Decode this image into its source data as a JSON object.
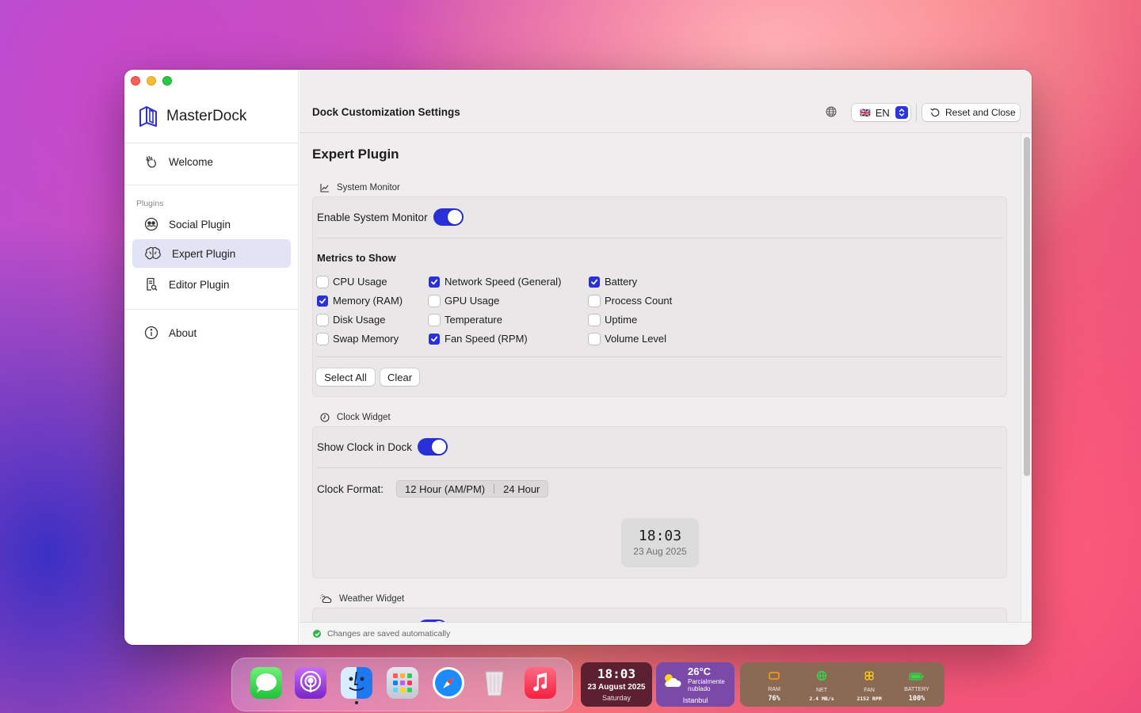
{
  "app": {
    "name": "MasterDock"
  },
  "sidebar": {
    "welcome": "Welcome",
    "plugins_section": "Plugins",
    "items": [
      {
        "label": "Social Plugin"
      },
      {
        "label": "Expert Plugin",
        "active": true
      },
      {
        "label": "Editor Plugin"
      }
    ],
    "about": "About"
  },
  "toolbar": {
    "title": "Dock Customization Settings",
    "language": {
      "flag": "🇬🇧",
      "value": "EN"
    },
    "reset_label": "Reset and Close"
  },
  "page": {
    "title": "Expert Plugin"
  },
  "system_monitor": {
    "section_label": "System Monitor",
    "enable_label": "Enable System Monitor",
    "enabled": true,
    "metrics_title": "Metrics to Show",
    "metrics": [
      {
        "label": "CPU Usage",
        "checked": false
      },
      {
        "label": "Memory (RAM)",
        "checked": true
      },
      {
        "label": "Disk Usage",
        "checked": false
      },
      {
        "label": "Swap Memory",
        "checked": false
      },
      {
        "label": "Network Speed (General)",
        "checked": true
      },
      {
        "label": "GPU Usage",
        "checked": false
      },
      {
        "label": "Temperature",
        "checked": false
      },
      {
        "label": "Fan Speed (RPM)",
        "checked": true
      },
      {
        "label": "Battery",
        "checked": true
      },
      {
        "label": "Process Count",
        "checked": false
      },
      {
        "label": "Uptime",
        "checked": false
      },
      {
        "label": "Volume Level",
        "checked": false
      }
    ],
    "select_all": "Select All",
    "clear": "Clear"
  },
  "clock_widget": {
    "section_label": "Clock Widget",
    "show_label": "Show Clock in Dock",
    "enabled": true,
    "format_label": "Clock Format:",
    "format_options": [
      "12 Hour (AM/PM)",
      "24 Hour"
    ],
    "preview_time": "18:03",
    "preview_date": "23 Aug 2025"
  },
  "weather_widget": {
    "section_label": "Weather Widget"
  },
  "status": {
    "text": "Changes are saved automatically"
  },
  "dock": {
    "clock": {
      "time": "18:03",
      "date": "23 August 2025",
      "day": "Saturday"
    },
    "weather": {
      "temp": "26°C",
      "desc1": "Parcialmente",
      "desc2": "nublado",
      "city": "Istanbul"
    },
    "stats": [
      {
        "label": "RAM",
        "value": "76%",
        "icon": "memory-icon",
        "color": "#ff9f0a"
      },
      {
        "label": "NET",
        "value": "2.4 MB/s",
        "icon": "network-icon",
        "color": "#32d74b"
      },
      {
        "label": "FAN",
        "value": "2152 RPM",
        "icon": "fan-icon",
        "color": "#ffd60a"
      },
      {
        "label": "BATTERY",
        "value": "100%",
        "icon": "battery-icon",
        "color": "#32d74b"
      }
    ]
  },
  "colors": {
    "accent": "#2a30d8",
    "active_nav": "#e2e3f5"
  }
}
